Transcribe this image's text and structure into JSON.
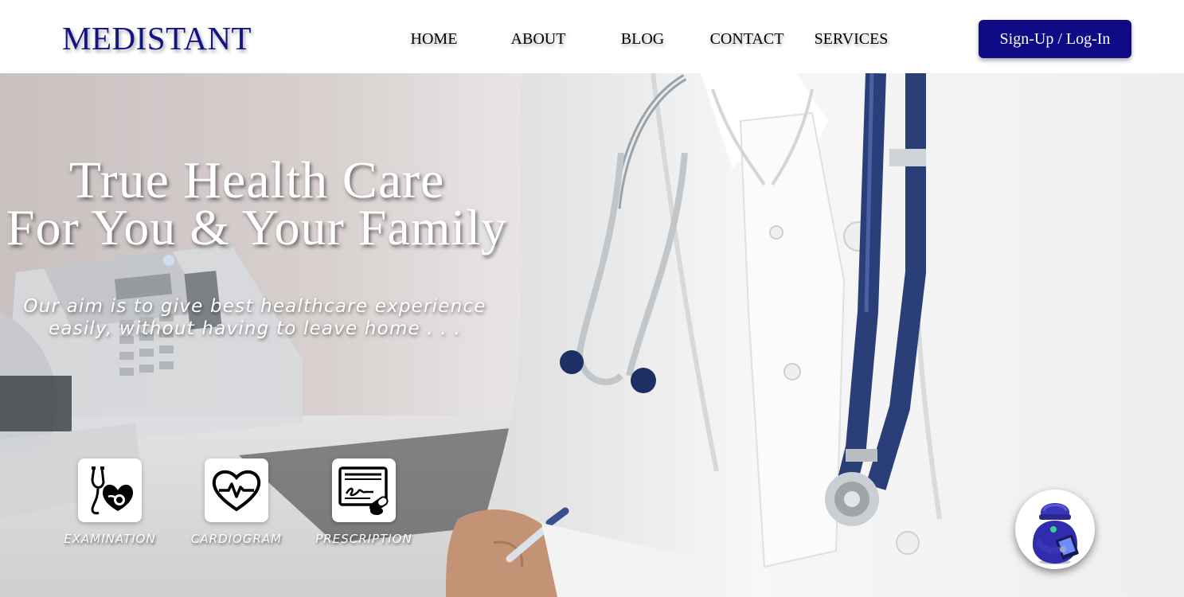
{
  "header": {
    "logo": "MEDISTANT",
    "nav": [
      "HOME",
      "ABOUT",
      "BLOG",
      "CONTACT",
      "SERVICES"
    ],
    "signup_label": "Sign-Up / Log-In"
  },
  "hero": {
    "title_line1": "True Health Care",
    "title_line2": "For You & Your Family",
    "subtitle_line1": "Our aim is to give best healthcare experience",
    "subtitle_line2": "easily, without having to leave home . . ."
  },
  "features": [
    {
      "label": "EXAMINATION",
      "icon": "stethoscope-heart-icon"
    },
    {
      "label": "CARDIOGRAM",
      "icon": "heartbeat-icon"
    },
    {
      "label": "PRESCRIPTION",
      "icon": "prescription-icon"
    }
  ],
  "chatbot": {
    "icon": "robot-assistant-icon"
  },
  "colors": {
    "brand": "#141487",
    "button": "#0f0b86",
    "stethoscope": "#233a73"
  }
}
